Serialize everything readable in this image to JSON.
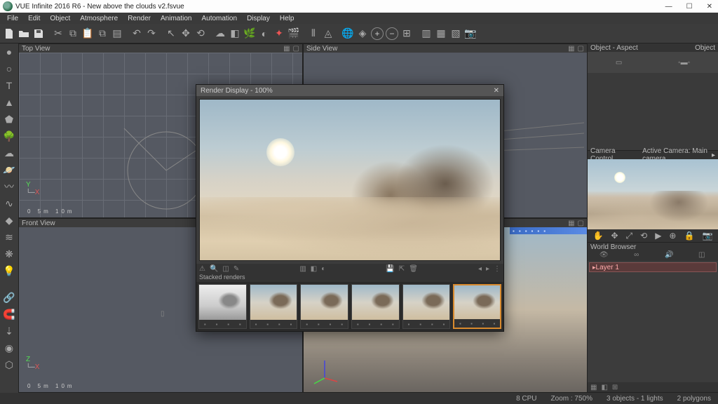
{
  "title": "VUE Infinite 2016 R6 - New above the clouds v2.fsvue",
  "menu": [
    "File",
    "Edit",
    "Object",
    "Atmosphere",
    "Render",
    "Animation",
    "Automation",
    "Display",
    "Help"
  ],
  "views": {
    "top": "Top View",
    "side": "Side View",
    "front": "Front View",
    "main": "Main camera"
  },
  "scale1": "0   5m   10m",
  "scale2": "0   5m   10m",
  "panels": {
    "objaspect": "Object - Aspect",
    "object": "Object",
    "camctrl": "Camera Control",
    "activecam": "Active Camera: Main camera",
    "world": "World Browser"
  },
  "layer": "Layer 1",
  "render": {
    "title": "Render Display - 100%",
    "stack": "Stacked renders"
  },
  "status": {
    "cpu": "8 CPU",
    "zoom": "Zoom : 750%",
    "obj": "3 objects - 1 lights",
    "poly": "2 polygons"
  }
}
